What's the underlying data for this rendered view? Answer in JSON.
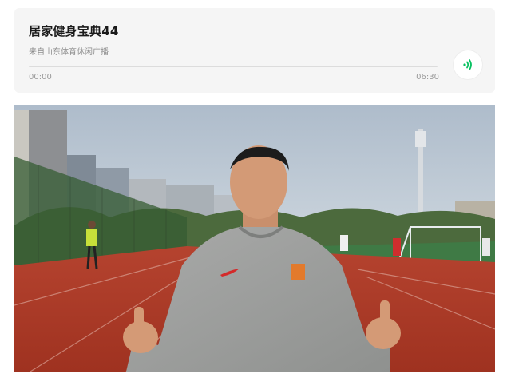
{
  "audio": {
    "title": "居家健身宝典44",
    "source": "来自山东体育休闲广播",
    "time_current": "00:00",
    "time_total": "06:30",
    "progress_fraction": 0.0,
    "play_icon": "sound-wave-icon",
    "accent_color": "#07c160"
  },
  "photo": {
    "subject": "smiling-man-thumbs-up-on-running-track"
  }
}
